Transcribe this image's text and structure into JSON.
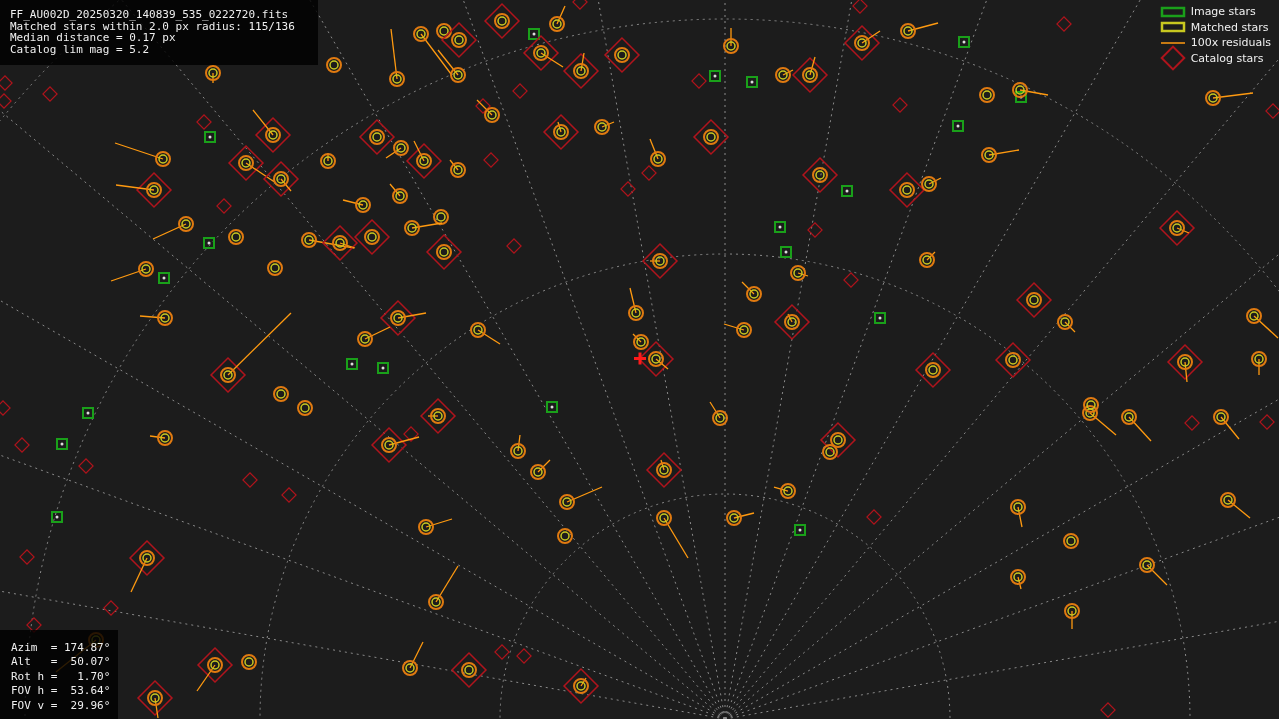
{
  "info_panel": {
    "lines": [
      "FF_AU002D_20250320_140839_535_0222720.fits",
      "Matched stars within 2.0 px radius: 115/136",
      "Median distance = 0.17 px",
      "Catalog lim mag = 5.2"
    ]
  },
  "legend": [
    {
      "kind": "image",
      "label": "Image stars"
    },
    {
      "kind": "matched",
      "label": "Matched stars"
    },
    {
      "kind": "residual",
      "label": "100x residuals"
    },
    {
      "kind": "catalog",
      "label": "Catalog stars"
    }
  ],
  "pointing_panel": {
    "lines": [
      "Azim  = 174.87°",
      "Alt   =  50.07°",
      "Rot h =   1.70°",
      "FOV h =  53.64°",
      "FOV v =  29.96°"
    ]
  }
}
